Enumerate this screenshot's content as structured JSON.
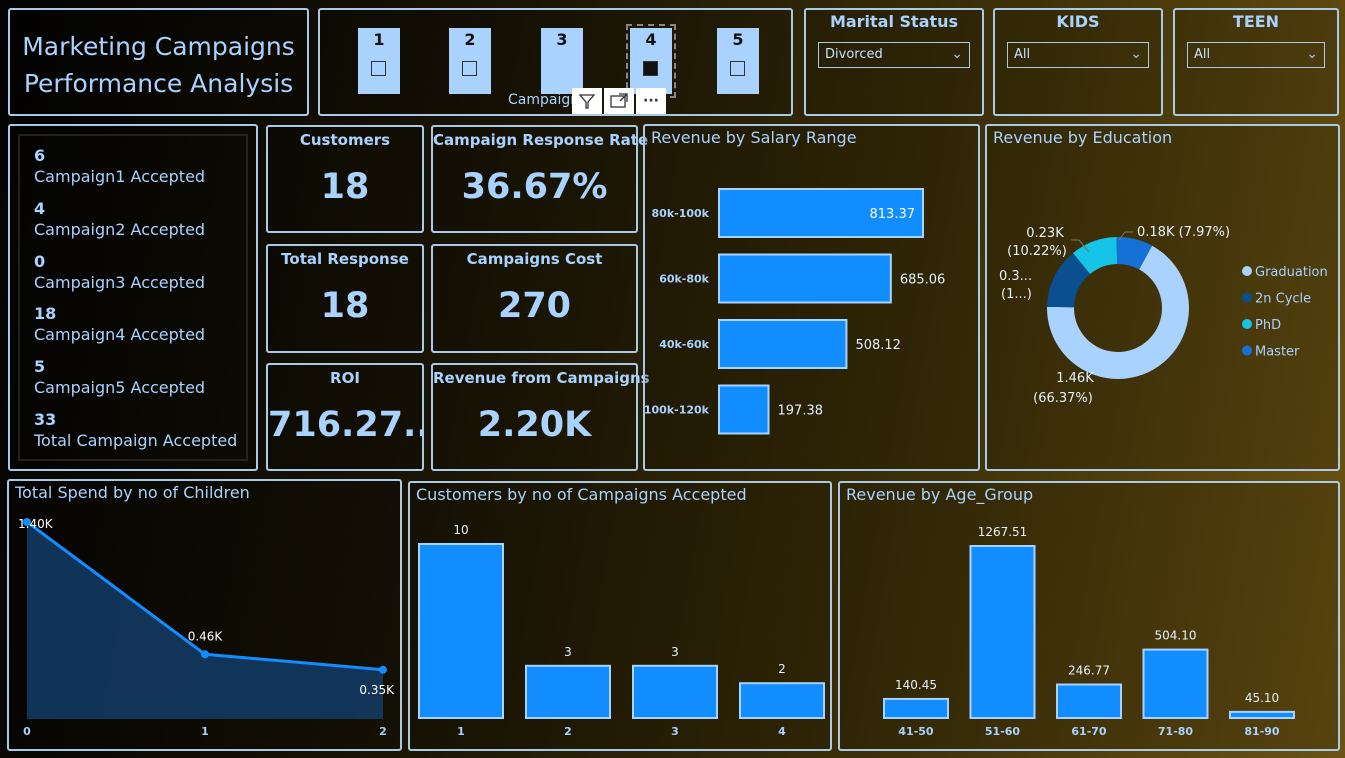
{
  "title": {
    "line1": "Marketing Campaigns",
    "line2": "Performance Analysis"
  },
  "campaign_slicer": {
    "tiles": [
      {
        "label": "1",
        "checked": false
      },
      {
        "label": "2",
        "checked": false
      },
      {
        "label": "3",
        "checked": false
      },
      {
        "label": "4",
        "checked": true
      },
      {
        "label": "5",
        "checked": false
      }
    ],
    "caption": "Campaign No",
    "toolbar": {
      "filter_icon": "filter-icon",
      "focus_icon": "focus-mode-icon",
      "more_icon": "more-options-icon",
      "more_label": "···"
    }
  },
  "filters": {
    "marital": {
      "label": "Marital Status",
      "value": "Divorced"
    },
    "kids": {
      "label": "KIDS",
      "value": "All"
    },
    "teen": {
      "label": "TEEN",
      "value": "All"
    }
  },
  "accepted": [
    {
      "count": "6",
      "label": "Campaign1 Accepted"
    },
    {
      "count": "4",
      "label": "Campaign2 Accepted"
    },
    {
      "count": "0",
      "label": "Campaign3 Accepted"
    },
    {
      "count": "18",
      "label": "Campaign4 Accepted"
    },
    {
      "count": "5",
      "label": "Campaign5 Accepted"
    },
    {
      "count": "33",
      "label": "Total Campaign Accepted"
    }
  ],
  "kpis": {
    "customers": {
      "label": "Customers",
      "value": "18"
    },
    "response_rate": {
      "label": "Campaign Response Rate",
      "value": "36.67%"
    },
    "total_response": {
      "label": "Total Response",
      "value": "18"
    },
    "campaigns_cost": {
      "label": "Campaigns Cost",
      "value": "270"
    },
    "roi": {
      "label": "ROI",
      "value": "716.27..."
    },
    "revenue": {
      "label": "Revenue from Campaigns",
      "value": "2.20K"
    }
  },
  "colors": {
    "bar": "#118dff",
    "bar_border": "#a9d2ff",
    "text": "#a9d2ff"
  },
  "chart_data": [
    {
      "id": "salary",
      "type": "bar",
      "orientation": "horizontal",
      "title": "Revenue by Salary Range",
      "categories": [
        "80k-100k",
        "60k-80k",
        "40k-60k",
        "100k-120k"
      ],
      "values": [
        813.37,
        685.06,
        508.12,
        197.38
      ],
      "labels": [
        "813.37",
        "685.06",
        "508.12",
        "197.38"
      ]
    },
    {
      "id": "education",
      "type": "pie",
      "title": "Revenue by Education",
      "categories": [
        "Graduation",
        "2n Cycle",
        "PhD",
        "Master"
      ],
      "values": [
        1.46,
        0.3,
        0.23,
        0.18
      ],
      "percents": [
        66.37,
        15.44,
        10.22,
        7.97
      ],
      "labels": [
        {
          "line1": "1.46K",
          "line2": "(66.37%)"
        },
        {
          "line1": "0.3...",
          "line2": "(1...)"
        },
        {
          "line1": "0.23K",
          "line2": "(10.22%)"
        },
        {
          "line1": "0.18K (7.97%)",
          "line2": ""
        }
      ],
      "colors": [
        "#a9d2ff",
        "#0a4f8f",
        "#16c4e8",
        "#1571d6"
      ],
      "legend_position": "right"
    },
    {
      "id": "children",
      "type": "area",
      "title": "Total Spend by no of Children",
      "x": [
        "0",
        "1",
        "2"
      ],
      "values": [
        1.4,
        0.46,
        0.35
      ],
      "labels": [
        "1.40K",
        "0.46K",
        "0.35K"
      ]
    },
    {
      "id": "campaigns",
      "type": "bar",
      "title": "Customers by no of Campaigns Accepted",
      "categories": [
        "1",
        "2",
        "3",
        "4"
      ],
      "values": [
        10,
        3,
        3,
        2
      ],
      "labels": [
        "10",
        "3",
        "3",
        "2"
      ]
    },
    {
      "id": "age",
      "type": "bar",
      "title": "Revenue by Age_Group",
      "categories": [
        "41-50",
        "51-60",
        "61-70",
        "71-80",
        "81-90"
      ],
      "values": [
        140.45,
        1267.51,
        246.77,
        504.1,
        45.1
      ],
      "labels": [
        "140.45",
        "1267.51",
        "246.77",
        "504.10",
        "45.10"
      ]
    }
  ]
}
